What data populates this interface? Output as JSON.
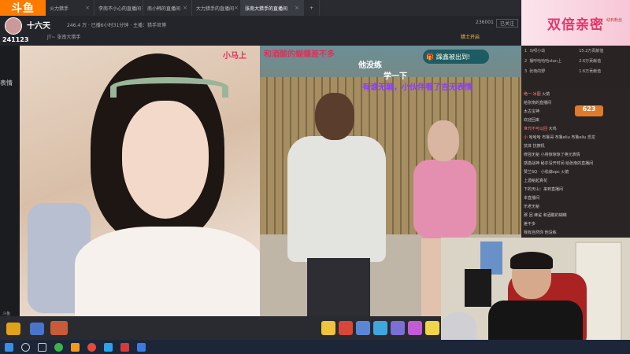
{
  "app": {
    "logo": "斗鱼"
  },
  "tabs": [
    {
      "label": "火力猎手",
      "active": false
    },
    {
      "label": "李南不小心的直播间",
      "active": false
    },
    {
      "label": "南小韩的直播间",
      "active": false
    },
    {
      "label": "大力猎手的直播间",
      "active": false
    },
    {
      "label": "张南大猎手的直播间",
      "active": true
    }
  ],
  "room": {
    "title": "十六天",
    "stats": "246.4 万 · 已播6小时31分钟 · 主播：猎手官博",
    "tag": "JT~ 张南大猎手",
    "id": "241123",
    "right_badge": "猎士开启",
    "right_count": "236001",
    "follow": "已关注"
  },
  "left_label": "表情",
  "video": {
    "left_name_tag": "小马上",
    "subs": [
      "和酒酸的蝴蝶差不多",
      "他没练",
      "学一下",
      "有谁无聊，小伙伴看了吉无表情"
    ],
    "prize_badge": "躁鑫被出到!"
  },
  "side": {
    "banner": "双倍亲密",
    "top_link": "幼石粉丝",
    "rank_header": "排行",
    "ranks": [
      {
        "pos": "1",
        "name": "马呗小幼",
        "value": "15.2万贡献值"
      },
      {
        "pos": "2",
        "name": "播呼哈哈哈stan上",
        "value": "2.6万贡献值"
      },
      {
        "pos": "3",
        "name": "张南的野",
        "value": "1.6万贡献值"
      }
    ],
    "chat": [
      {
        "user": "绝一·冰图",
        "text": "火箭"
      },
      {
        "user": "",
        "text": "给张南的直播间"
      },
      {
        "user": "",
        "text": "太古宝神"
      },
      {
        "user": "",
        "text": "欢迎回来"
      },
      {
        "user": "世代不可以回",
        "text": "大鸡"
      },
      {
        "user": "小",
        "text": "哈哈哈 布鲁哥 布鲁eliu 布鲁eliu 恐龙"
      },
      {
        "user": "",
        "text": "抗体 抗擦机"
      },
      {
        "user": "",
        "text": "修强无秘 小将惊惊惊了英元表情"
      },
      {
        "user": "",
        "text": "感激战神 秘亦没开时间 给张南的直播间"
      },
      {
        "user": "",
        "text": "赞兰SQ · 小松蒜xpc 火箭"
      },
      {
        "user": "",
        "text": "上酒秘起真花"
      },
      {
        "user": "",
        "text": "下的天山：来到直播间"
      },
      {
        "user": "",
        "text": "本直播间"
      },
      {
        "user": "",
        "text": "乐老无秘"
      },
      {
        "user": "",
        "text": "那 回 蜂鲨 和酒酸的蝴蝶"
      },
      {
        "user": "",
        "text": "差不多"
      },
      {
        "user": "",
        "text": "我有自然你 他没练"
      }
    ],
    "score_badge": "623"
  },
  "bottom": {
    "left_label": "斗鱼",
    "icons": [
      "trophy-icon",
      "gift-icon",
      "fish-icon"
    ]
  },
  "taskbar": {
    "icons": [
      "windows-icon",
      "search-icon",
      "taskview-icon",
      "chrome-icon",
      "folder-icon",
      "qq-icon",
      "media-icon",
      "douyu-icon"
    ]
  },
  "colors": {
    "accent": "#ff7a00",
    "banner_text": "#e6336b"
  }
}
